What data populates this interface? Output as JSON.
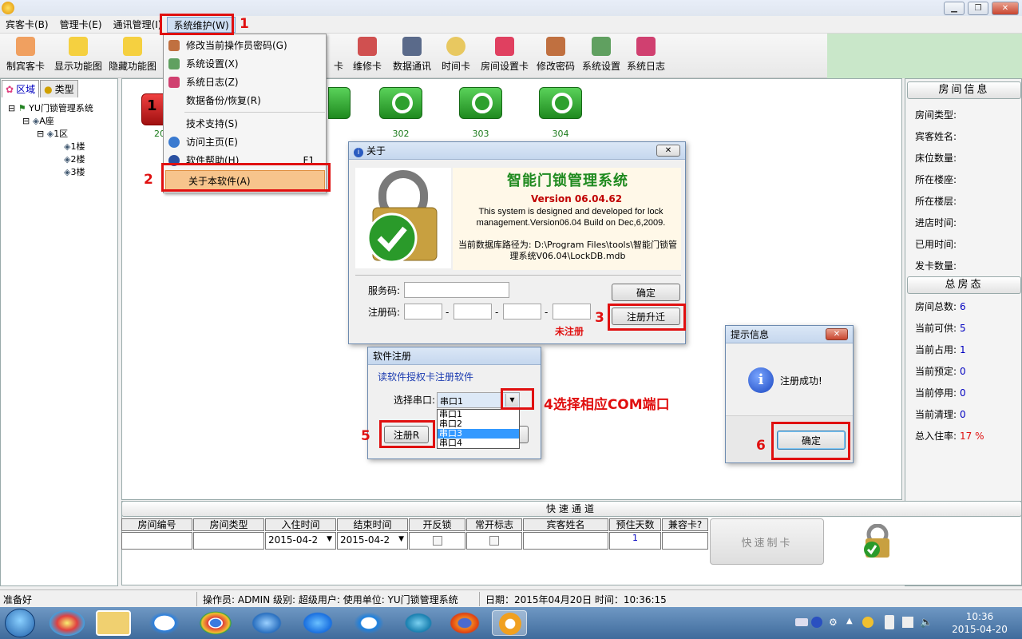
{
  "window": {
    "min_label": "▁",
    "max_label": "❐",
    "close_label": "✕"
  },
  "menubar": [
    "宾客卡(B)",
    "管理卡(E)",
    "通讯管理(I)",
    "系统维护(W)"
  ],
  "toolbar": [
    "制宾客卡",
    "显示功能图",
    "隐藏功能图",
    "卡",
    "维修卡",
    "数据通讯",
    "时间卡",
    "房间设置卡",
    "修改密码",
    "系统设置",
    "系统日志"
  ],
  "left_tabs": [
    "区域",
    "类型"
  ],
  "tree": {
    "root": "YU门锁管理系统",
    "building": "A座",
    "zone": "1区",
    "floors": [
      "1楼",
      "2楼",
      "3楼"
    ]
  },
  "rooms": {
    "first": "20",
    "others": [
      "302",
      "303",
      "304"
    ],
    "first_badge": "1"
  },
  "dropdown_menu": {
    "items": [
      "修改当前操作员密码(G)",
      "系统设置(X)",
      "系统日志(Z)",
      "数据备份/恢复(R)",
      "技术支持(S)",
      "访问主页(E)",
      "软件帮助(H)",
      "关于本软件(A)"
    ],
    "help_shortcut": "F1"
  },
  "about_dialog": {
    "title": "关于",
    "app_name": "智能门锁管理系统",
    "version": "Version 06.04.62",
    "description": "This system is designed and developed for lock management.Version06.04 Build on Dec,6,2009.",
    "db_path": "当前数据库路径为: D:\\Program Files\\tools\\智能门锁管理系统V06.04\\LockDB.mdb",
    "service_label": "服务码:",
    "reg_label": "注册码:",
    "dash": "-",
    "ok_button": "确定",
    "register_upgrade_button": "注册升迁",
    "unregistered": "未注册"
  },
  "reg_dialog": {
    "title": "软件注册",
    "subtitle": "读软件授权卡注册软件",
    "port_label": "选择串口:",
    "selected_port": "串口1",
    "port_options": [
      "串口1",
      "串口2",
      "串口3",
      "串口4"
    ],
    "register_button": "注册R"
  },
  "info_dialog": {
    "title": "提示信息",
    "message": "注册成功!",
    "ok_button": "确定",
    "close_label": "✕"
  },
  "right_panel": {
    "room_info_title": "房间信息",
    "room_info_fields": [
      "房间类型:",
      "宾客姓名:",
      "床位数量:",
      "所在楼座:",
      "所在楼层:",
      "进店时间:",
      "已用时间:",
      "发卡数量:"
    ],
    "status_title": "总房态",
    "status_fields": [
      {
        "label": "房间总数:",
        "value": "6"
      },
      {
        "label": "当前可供:",
        "value": "5"
      },
      {
        "label": "当前占用:",
        "value": "1"
      },
      {
        "label": "当前预定:",
        "value": "0"
      },
      {
        "label": "当前停用:",
        "value": "0"
      },
      {
        "label": "当前清理:",
        "value": "0"
      },
      {
        "label": "总入住率:",
        "value": "17 %"
      }
    ]
  },
  "quick_panel": {
    "title": "快速通道",
    "columns": [
      "房间编号",
      "房间类型",
      "入住时间",
      "结束时间",
      "开反锁",
      "常开标志",
      "宾客姓名",
      "预住天数",
      "兼容卡?"
    ],
    "checkin": "2015-04-2",
    "checkout": "2015-04-2",
    "days": "1",
    "make_card_button": "快速制卡"
  },
  "annotations": {
    "step1": "1",
    "step2": "2",
    "step3": "3",
    "step4": "4选择相应COM端口",
    "step5": "5",
    "step6": "6"
  },
  "statusbar": {
    "ready": "准备好",
    "operator": "操作员: ADMIN 级别: 超级用户: 使用单位: YU门锁管理系统",
    "datetime": "日期：2015年04月20日 时间：10:36:15"
  },
  "taskbar": {
    "time": "10:36",
    "date": "2015-04-20"
  },
  "colors": {
    "accent_red": "#e01010",
    "room_green": "#1f8a1f",
    "value_blue": "#0000c0"
  }
}
